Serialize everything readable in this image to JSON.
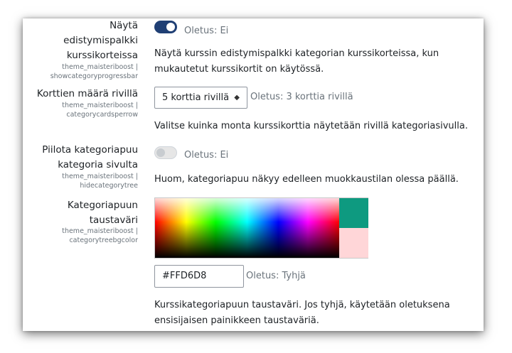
{
  "settings": [
    {
      "label_lines": [
        "Näytä",
        "edistymispalkki",
        "kurssikorteissa"
      ],
      "key_lines": [
        "theme_maisteriboost |",
        "showcategoryprogressbar"
      ],
      "control": "toggle",
      "checked": true,
      "default": "Oletus: Ei",
      "description_lines": [
        "Näytä kurssin edistymispalkki kategorian kurssikorteissa, kun",
        "mukautetut kurssikortit on käytössä."
      ]
    },
    {
      "label_lines": [
        "Korttien määrä rivillä"
      ],
      "key_lines": [
        "theme_maisteriboost |",
        "categorycardsperrow"
      ],
      "control": "select",
      "selected": "5 korttia rivillä",
      "default": "Oletus: 3 korttia rivillä",
      "description_lines": [
        "Valitse kuinka monta kurssikorttia näytetään rivillä kategoriasivulla."
      ]
    },
    {
      "label_lines": [
        "Piilota kategoriapuu",
        "kategoria sivulta"
      ],
      "key_lines": [
        "theme_maisteriboost |",
        "hidecategorytree"
      ],
      "control": "toggle",
      "checked": false,
      "default": "Oletus: Ei",
      "description_lines": [
        "Huom, kategoriapuu näkyy edelleen muokkaustilan olessa päällä."
      ]
    },
    {
      "label_lines": [
        "Kategoriapuun",
        "taustaväri"
      ],
      "key_lines": [
        "theme_maisteriboost |",
        "categorytreebgcolor"
      ],
      "control": "colorpicker",
      "value": "#FFD6D8",
      "default": "Oletus: Tyhjä",
      "description_lines": [
        "Kurssikategoriapuun taustaväri. Jos tyhjä, käytetään oletuksena",
        "ensisijaisen painikkeen taustaväriä."
      ]
    }
  ],
  "colors": {
    "toggle_on": "#1f3f74",
    "picker_previous": "#0e9a80",
    "picker_current": "#ffd6d8"
  }
}
